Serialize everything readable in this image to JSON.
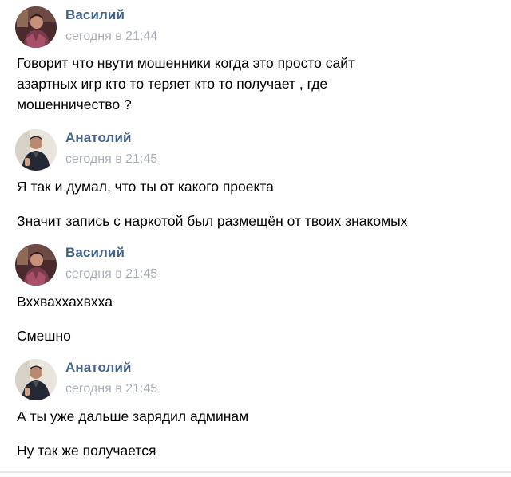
{
  "messages": [
    {
      "author": "Василий",
      "time": "сегодня в 21:44",
      "avatar": "vasily-avatar",
      "lines": [
        "Говорит что нвути мошенники когда это просто сайт",
        "азартных игр кто то теряет кто то получает , где",
        "мошенничество ?"
      ]
    },
    {
      "author": "Анатолий",
      "time": "сегодня в 21:45",
      "avatar": "anatoly-avatar",
      "lines": [
        "Я так и думал, что ты от какого проекта",
        "Значит запись с наркотой был размещён от твоих знакомых"
      ]
    },
    {
      "author": "Василий",
      "time": "сегодня в 21:45",
      "avatar": "vasily-avatar",
      "lines": [
        "Вххваххахвхха",
        "Смешно"
      ]
    },
    {
      "author": "Анатолий",
      "time": "сегодня в 21:45",
      "avatar": "anatoly-avatar",
      "lines": [
        "А ты уже дальше зарядил админам",
        "Ну так же получается"
      ]
    }
  ],
  "colors": {
    "author": "#42648b",
    "time": "#a9b0b8",
    "text": "#000000",
    "background": "#ffffff"
  }
}
